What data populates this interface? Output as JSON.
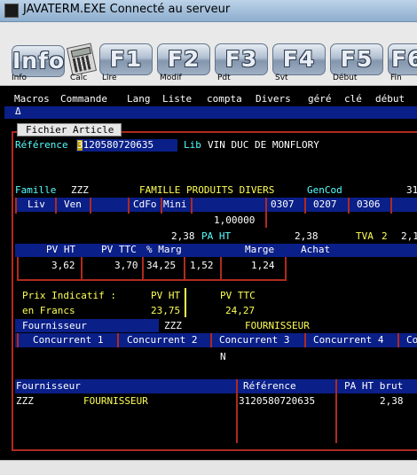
{
  "window": {
    "title": "JAVATERM.EXE Connecté au serveur"
  },
  "toolbar": {
    "buttons": [
      {
        "key": "Info",
        "label": "Info"
      },
      {
        "key": "",
        "label": "Calc"
      },
      {
        "key": "F1",
        "label": "Lire"
      },
      {
        "key": "F2",
        "label": "Modif"
      },
      {
        "key": "F3",
        "label": "Pdt"
      },
      {
        "key": "F4",
        "label": "Svt"
      },
      {
        "key": "F5",
        "label": "Début"
      },
      {
        "key": "F6",
        "label": "Fin"
      }
    ]
  },
  "menu": {
    "items": [
      "Macros",
      "Commande",
      "Lang",
      "Liste",
      "compta",
      "Divers",
      "géré",
      "clé",
      "début"
    ],
    "prompt": "Δ"
  },
  "tab": {
    "label": "Fichier Article"
  },
  "article": {
    "reference_label": "Référence",
    "reference_value": "3120580720635",
    "lib_label": "Lib",
    "lib_value": "VIN DUC DE MONFLORY",
    "famille_label": "Famille",
    "famille_code": "ZZZ",
    "famille_name": "FAMILLE PRODUITS DIVERS",
    "gencod_label": "GenCod",
    "gencod_value": "31",
    "col_liv": "Liv",
    "col_ven": "Ven",
    "col_cdfo": "CdFo",
    "col_mini": "Mini",
    "code1": "0307",
    "code2": "0207",
    "code3": "0306",
    "qty_value": "1,00000",
    "pa_ht_value": "2,38",
    "pa_ht_label": "PA HT",
    "pa_ht_value2": "2,38",
    "tva_label": "TVA",
    "tva_value": "2",
    "tva_rate": "2,1"
  },
  "pricing": {
    "headers": {
      "pv_ht": "PV HT",
      "pv_ttc": "PV TTC",
      "pct_marg": "% Marg",
      "marge": "Marge",
      "achat": "Achat"
    },
    "values": {
      "pv_ht": "3,62",
      "pv_ttc": "3,70",
      "pct_marg": "34,25",
      "coef": "1,52",
      "marge": "1,24"
    }
  },
  "indicative": {
    "label1": "Prix Indicatif :",
    "label2": "en Francs",
    "pv_ht_label": "PV HT",
    "pv_ttc_label": "PV TTC",
    "pv_ht_value": "23,75",
    "pv_ttc_value": "24,27"
  },
  "supplier": {
    "label": "Fournisseur",
    "code": "ZZZ",
    "name": "FOURNISSEUR"
  },
  "competitors": {
    "tabs": [
      "Concurrent 1",
      "Concurrent 2",
      "Concurrent 3",
      "Concurrent 4",
      "Co"
    ],
    "value": "N"
  },
  "supplier_table": {
    "headers": [
      "Fournisseur",
      "Référence",
      "PA HT brut"
    ],
    "rows": [
      {
        "code": "ZZZ",
        "name": "FOURNISSEUR",
        "reference": "3120580720635",
        "pa_ht_brut": "2,38"
      }
    ]
  },
  "colors": {
    "term_blue": "#0a1f88",
    "frame_red": "#b02a1e",
    "yellow": "#ffff55",
    "cyan": "#55ffff"
  }
}
